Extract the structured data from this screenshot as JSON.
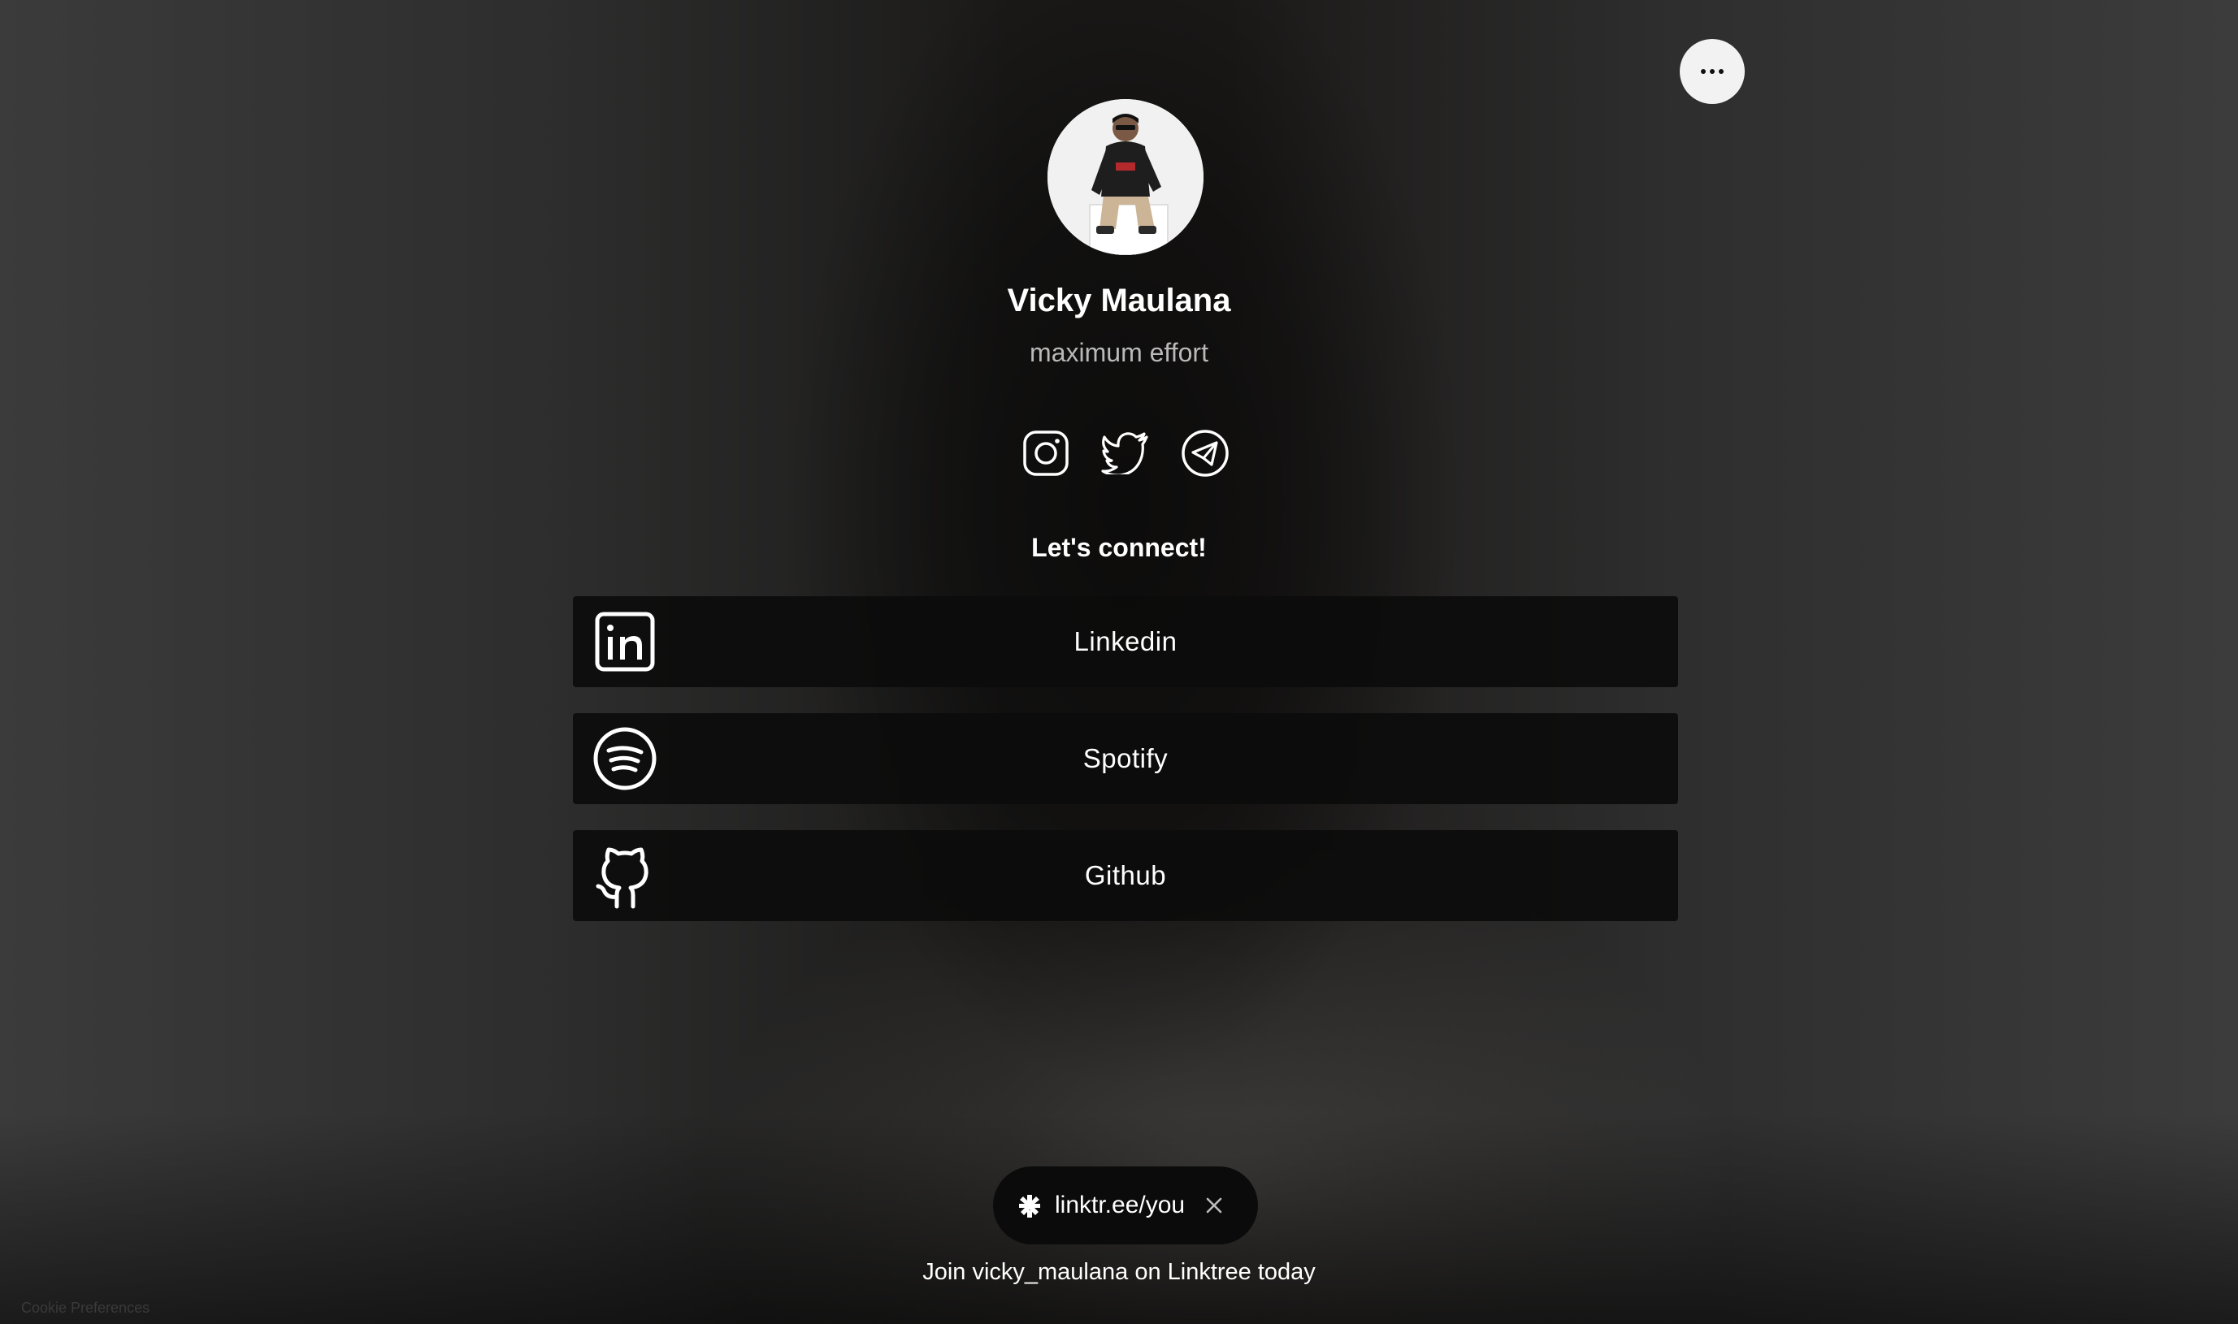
{
  "header": {
    "more_icon": "ellipsis-icon"
  },
  "profile": {
    "name": "Vicky Maulana",
    "bio": "maximum effort",
    "avatar_alt": "profile-photo"
  },
  "socials": [
    {
      "icon": "instagram-icon"
    },
    {
      "icon": "twitter-icon"
    },
    {
      "icon": "telegram-icon"
    }
  ],
  "section": {
    "title": "Let's connect!"
  },
  "links": [
    {
      "label": "Linkedin",
      "icon": "linkedin-icon"
    },
    {
      "label": "Spotify",
      "icon": "spotify-icon"
    },
    {
      "label": "Github",
      "icon": "github-icon"
    }
  ],
  "promo": {
    "pill_text": "linktr.ee/you",
    "join_text": "Join vicky_maulana on Linktree today"
  },
  "footer": {
    "cookie_text": "Cookie Preferences"
  },
  "colors": {
    "button_bg": "#0c0c0c",
    "text": "#ffffff",
    "bio_text": "#b9b9b9",
    "more_button_bg": "#f2f2f2"
  }
}
